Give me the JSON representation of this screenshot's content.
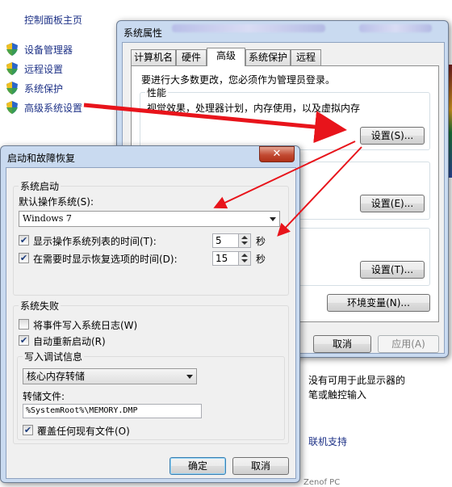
{
  "control_panel": {
    "home": "控制面板主页",
    "links": [
      "设备管理器",
      "远程设置",
      "系统保护",
      "高级系统设置"
    ],
    "right_lines": [
      "没有可用于此显示器的",
      "笔或触控输入"
    ],
    "support_link": "联机支持",
    "bottom_fragment": "Zenof PC"
  },
  "system_properties": {
    "title": "系统属性",
    "tabs": [
      "计算机名",
      "硬件",
      "高级",
      "系统保护",
      "远程"
    ],
    "active_tab": "高级",
    "admin_note": "要进行大多数更改，您必须作为管理员登录。",
    "performance": {
      "group": "性能",
      "desc": "视觉效果，处理器计划，内存使用，以及虚拟内存",
      "settings_button": "设置(S)..."
    },
    "profile_settings_button": "设置(E)...",
    "startup_settings_button": "设置(T)...",
    "env_vars_button": "环境变量(N)...",
    "cancel": "取消",
    "apply": "应用(A)"
  },
  "startup_recovery": {
    "title": "启动和故障恢复",
    "close": "✕",
    "system_startup": {
      "group": "系统启动",
      "default_os_label": "默认操作系统(S):",
      "default_os_value": "Windows 7",
      "show_os_list": {
        "label": "显示操作系统列表的时间(T):",
        "checked": true,
        "value": "5",
        "unit": "秒"
      },
      "show_recovery": {
        "label": "在需要时显示恢复选项的时间(D):",
        "checked": true,
        "value": "15",
        "unit": "秒"
      }
    },
    "system_failure": {
      "group": "系统失败",
      "write_event": {
        "label": "将事件写入系统日志(W)",
        "checked": false
      },
      "auto_restart": {
        "label": "自动重新启动(R)",
        "checked": true
      },
      "debug_info_label": "写入调试信息",
      "debug_info_value": "核心内存转储",
      "dump_file_label": "转储文件:",
      "dump_file_value": "%SystemRoot%\\MEMORY.DMP",
      "overwrite": {
        "label": "覆盖任何现有文件(O)",
        "checked": true
      }
    },
    "ok": "确定",
    "cancel": "取消"
  },
  "colors": {
    "arrow": "#e8141b",
    "link": "#1e3287",
    "title_bar": "#c9daf0",
    "close": "#c24a32"
  },
  "icons": {
    "control_panel_links": "uac-shield-icon",
    "check": "checkmark"
  }
}
